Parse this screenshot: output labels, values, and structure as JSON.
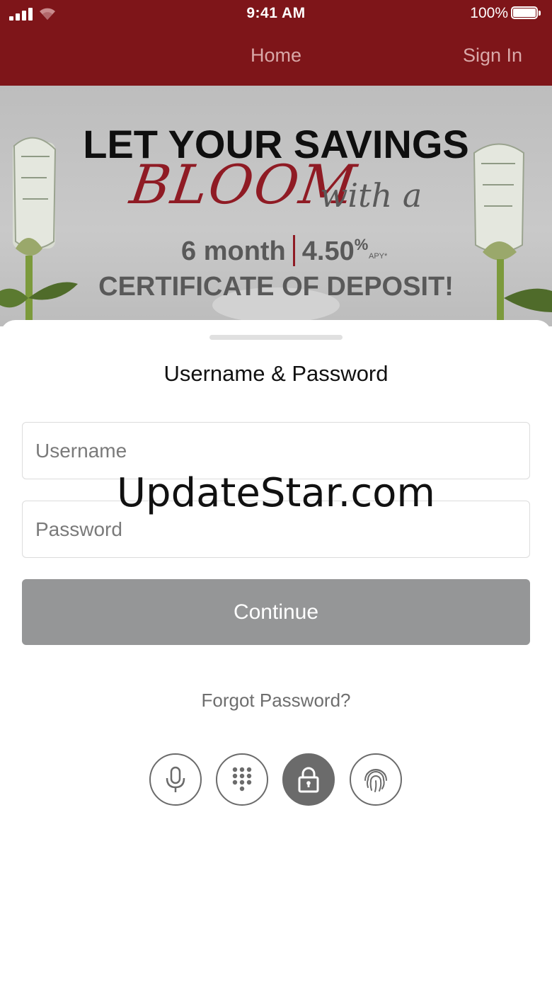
{
  "status_bar": {
    "time": "9:41 AM",
    "battery_percent": "100%",
    "battery_level": 1.0
  },
  "nav": {
    "home_label": "Home",
    "sign_in_label": "Sign In"
  },
  "banner": {
    "line1": "LET YOUR SAVINGS",
    "bloom": "BLOOM",
    "with_a": "with a",
    "term": "6 month",
    "rate": "4.50",
    "rate_suffix": "%",
    "apy_note": "APY*",
    "line4": "CERTIFICATE OF DEPOSIT!"
  },
  "login": {
    "title": "Username & Password",
    "username_placeholder": "Username",
    "password_placeholder": "Password",
    "continue_label": "Continue",
    "forgot_label": "Forgot Password?"
  },
  "auth_methods": [
    {
      "icon": "microphone-icon",
      "active": false
    },
    {
      "icon": "keypad-icon",
      "active": false
    },
    {
      "icon": "lock-icon",
      "active": true
    },
    {
      "icon": "fingerprint-icon",
      "active": false
    }
  ],
  "colors": {
    "brand": "#7e1519",
    "button_disabled": "#959697",
    "accent_red": "#8f1b24"
  },
  "watermark": "UpdateStar.com"
}
